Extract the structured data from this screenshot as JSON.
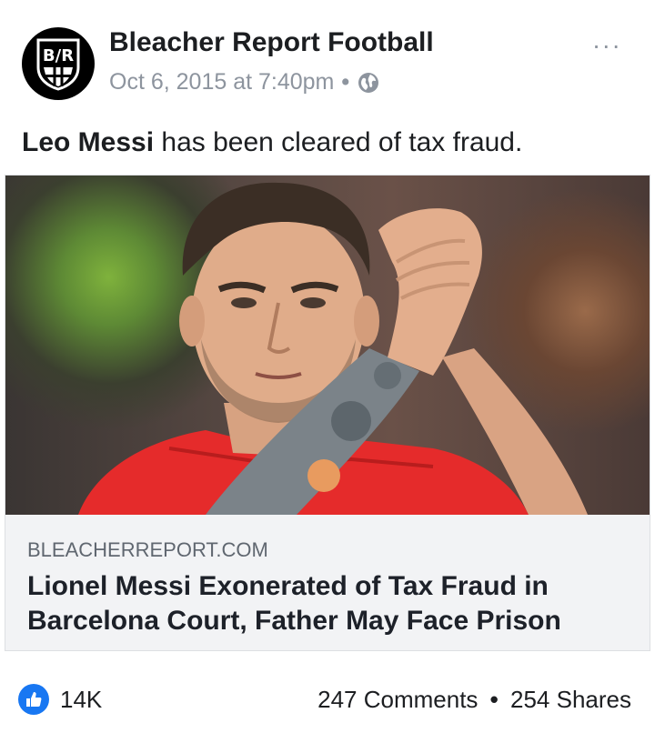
{
  "post": {
    "page_name": "Bleacher Report Football",
    "avatar_text": "B/R",
    "timestamp": "Oct 6, 2015 at 7:40pm",
    "meta_separator": "•",
    "privacy_icon": "globe-icon",
    "more_label": "...",
    "message_bold": "Leo Messi",
    "message_rest": " has been cleared of tax fraud."
  },
  "link": {
    "domain": "BLEACHERREPORT.COM",
    "headline": "Lionel Messi Exonerated of Tax Fraud in Barcelona Court, Father May Face Prison",
    "photo_icon": "player-photo"
  },
  "footer": {
    "reaction_icon": "like-icon",
    "likes": "14K",
    "comments": "247 Comments",
    "separator": "•",
    "shares": "254 Shares"
  },
  "colors": {
    "like_blue": "#1877f2",
    "meta_gray": "#8d949e",
    "link_bg": "#f2f3f5",
    "jersey_red": "#e52b2b"
  }
}
